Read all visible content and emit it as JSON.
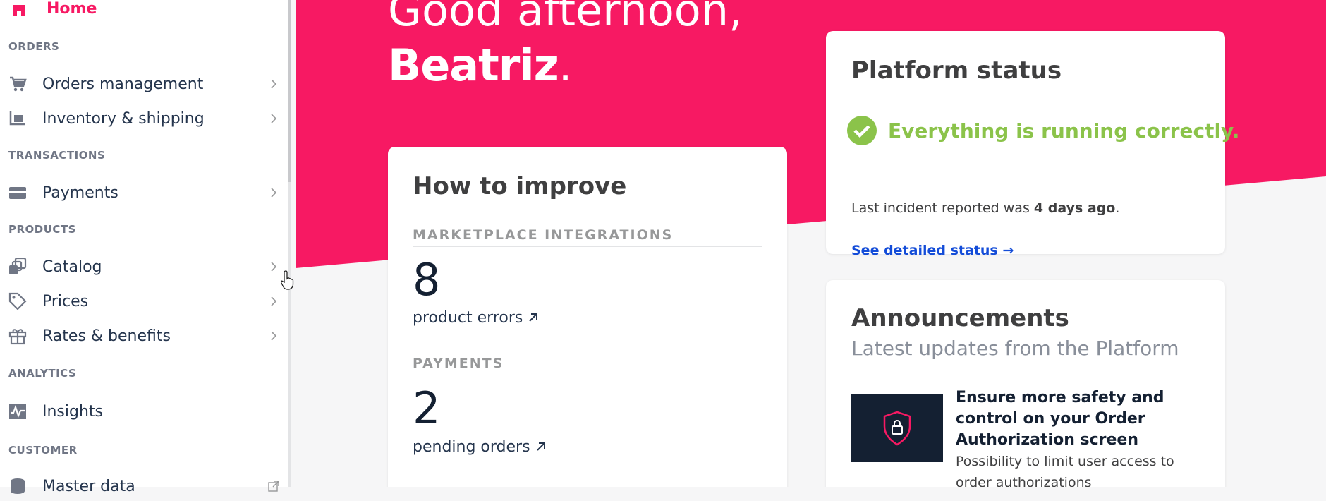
{
  "colors": {
    "brand": "#f71963",
    "success": "#8bc34a",
    "link": "#134cd8",
    "dark": "#142032"
  },
  "sidebar": {
    "home_label": "Home",
    "sections": [
      {
        "title": "ORDERS",
        "items": [
          {
            "label": "Orders management",
            "icon": "cart-icon",
            "has_chevron": true
          },
          {
            "label": "Inventory & shipping",
            "icon": "dolly-icon",
            "has_chevron": true
          }
        ]
      },
      {
        "title": "TRANSACTIONS",
        "items": [
          {
            "label": "Payments",
            "icon": "credit-card-icon",
            "has_chevron": true
          }
        ]
      },
      {
        "title": "PRODUCTS",
        "items": [
          {
            "label": "Catalog",
            "icon": "catalog-icon",
            "has_chevron": true
          },
          {
            "label": "Prices",
            "icon": "tag-icon",
            "has_chevron": true
          },
          {
            "label": "Rates & benefits",
            "icon": "gift-icon",
            "has_chevron": true
          }
        ]
      },
      {
        "title": "ANALYTICS",
        "items": [
          {
            "label": "Insights",
            "icon": "chart-icon",
            "has_chevron": false
          }
        ]
      },
      {
        "title": "CUSTOMER",
        "items": [
          {
            "label": "Master data",
            "icon": "database-icon",
            "has_chevron": false,
            "external": true
          }
        ]
      }
    ]
  },
  "hero": {
    "greeting": "Good afternoon,",
    "name": "Beatriz",
    "punct": "."
  },
  "improve": {
    "title": "How to improve",
    "groups": [
      {
        "caption": "MARKETPLACE INTEGRATIONS",
        "count": "8",
        "link": "product errors"
      },
      {
        "caption": "PAYMENTS",
        "count": "2",
        "link": "pending orders"
      }
    ]
  },
  "status": {
    "title": "Platform status",
    "message": "Everything is running correctly.",
    "incident_prefix": "Last incident reported was ",
    "incident_when": "4 days ago",
    "incident_suffix": ".",
    "detail_link": "See detailed status →"
  },
  "announcements": {
    "title": "Announcements",
    "subtitle": "Latest updates from the Platform",
    "item_title": "Ensure more safety and control on your Order Authorization screen",
    "item_desc": "Possibility to limit user access to order authorizations"
  }
}
